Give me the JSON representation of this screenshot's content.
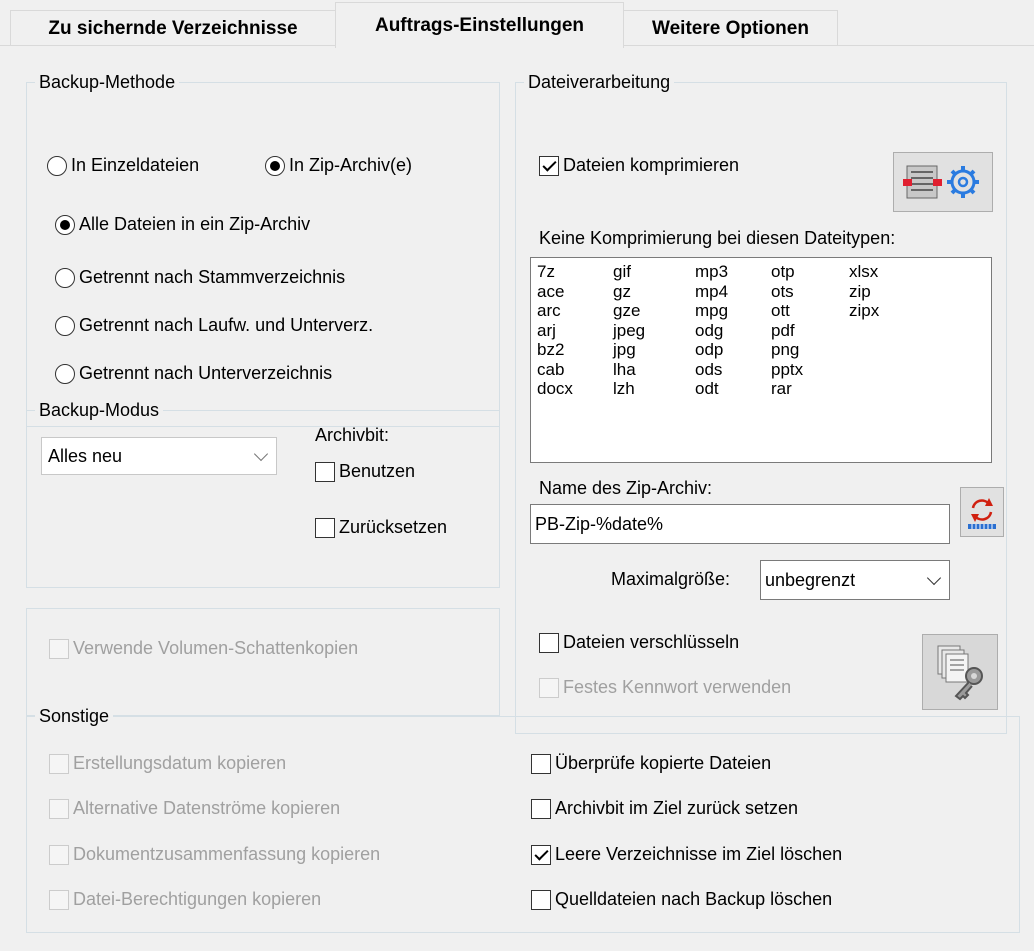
{
  "tabs": [
    "Zu sichernde Verzeichnisse",
    "Auftrags-Einstellungen",
    "Weitere Optionen"
  ],
  "backup_method": {
    "title": "Backup-Methode",
    "individual": "In Einzeldateien",
    "zip": "In Zip-Archiv(e)",
    "options": [
      "Alle Dateien in ein Zip-Archiv",
      "Getrennt nach Stammverzeichnis",
      "Getrennt nach Laufw. und Unterverz.",
      "Getrennt nach Unterverzeichnis"
    ]
  },
  "backup_mode": {
    "title": "Backup-Modus",
    "selected": "Alles neu",
    "archivbit_label": "Archivbit:",
    "use": "Benutzen",
    "reset": "Zurücksetzen"
  },
  "shadow_copy": "Verwende Volumen-Schattenkopien",
  "file_processing": {
    "title": "Dateiverarbeitung",
    "compress": "Dateien komprimieren",
    "no_compress_label": "Keine Komprimierung bei diesen Dateitypen:",
    "filetype_columns": [
      [
        "7z",
        "ace",
        "arc",
        "arj",
        "bz2",
        "cab",
        "docx"
      ],
      [
        "gif",
        "gz",
        "gze",
        "jpeg",
        "jpg",
        "lha",
        "lzh"
      ],
      [
        "mp3",
        "mp4",
        "mpg",
        "odg",
        "odp",
        "ods",
        "odt"
      ],
      [
        "otp",
        "ots",
        "ott",
        "pdf",
        "png",
        "pptx",
        "rar"
      ],
      [
        "xlsx",
        "zip",
        "zipx"
      ]
    ],
    "zip_name_label": "Name des Zip-Archiv:",
    "zip_name_value": "PB-Zip-%date%",
    "max_size_label": "Maximalgröße:",
    "max_size_value": "unbegrenzt",
    "encrypt": "Dateien verschlüsseln",
    "fixed_password": "Festes Kennwort verwenden"
  },
  "misc": {
    "title": "Sonstige",
    "left": [
      "Erstellungsdatum kopieren",
      "Alternative Datenströme kopieren",
      "Dokumentzusammenfassung kopieren",
      "Datei-Berechtigungen kopieren"
    ],
    "right": [
      "Überprüfe kopierte Dateien",
      "Archivbit im Ziel zurück setzen",
      "Leere Verzeichnisse im Ziel löschen",
      "Quelldateien nach Backup löschen"
    ]
  },
  "icons": {
    "compress_settings": "compress-settings-icon",
    "refresh_name": "refresh-name-icon",
    "encrypt_keys": "encryption-keys-icon"
  }
}
